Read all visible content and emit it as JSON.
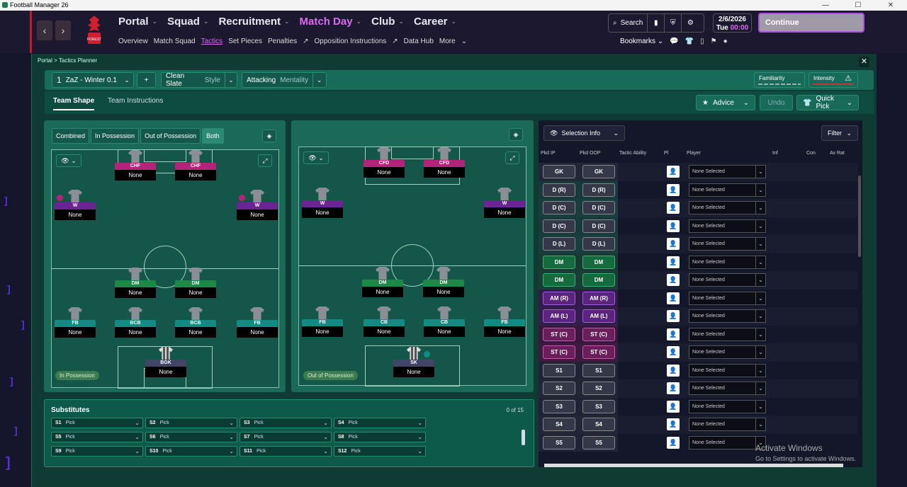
{
  "window": {
    "title": "Football Manager 26",
    "controls": [
      "—",
      "☐",
      "✕"
    ]
  },
  "nav": {
    "back": "‹",
    "forward": "›",
    "crest_text": "FOREST",
    "menu": [
      {
        "label": "Portal"
      },
      {
        "label": "Squad"
      },
      {
        "label": "Recruitment"
      },
      {
        "label": "Match Day"
      },
      {
        "label": "Club"
      },
      {
        "label": "Career"
      }
    ],
    "submenu": [
      "Overview",
      "Match Squad",
      "Tactics",
      "Set Pieces",
      "Penalties",
      "Opposition Instructions",
      "Data Hub",
      "More"
    ],
    "search_label": "Search",
    "date": "2/6/2026",
    "day": "Tue",
    "time": "00:00",
    "continue_label": "Continue",
    "bookmarks_label": "Bookmarks"
  },
  "breadcrumb": {
    "root": "Portal",
    "current": "Tactics Planner"
  },
  "toolbar": {
    "tactic_slot": "1",
    "tactic_name": "ZaZ - Winter 0.1",
    "add": "+",
    "style_value": "Clean Slate",
    "style_label": "Style",
    "mentality_value": "Attacking",
    "mentality_label": "Mentality",
    "familiarity": "Familiarity",
    "intensity": "Intensity"
  },
  "tabs": {
    "team_shape": "Team Shape",
    "team_instructions": "Team Instructions",
    "advice": "Advice",
    "undo": "Undo",
    "quick_pick": "Quick Pick"
  },
  "modes": [
    "Combined",
    "In Possession",
    "Out of Possession",
    "Both"
  ],
  "in_possession_label": "In Possession",
  "out_possession_label": "Out of Possession",
  "ip_players": [
    {
      "pos": "CHF",
      "name": "None",
      "c": "pink"
    },
    {
      "pos": "CHF",
      "name": "None",
      "c": "pink"
    },
    {
      "pos": "W",
      "name": "None",
      "c": "purple"
    },
    {
      "pos": "W",
      "name": "None",
      "c": "purple"
    },
    {
      "pos": "DM",
      "name": "None",
      "c": "green"
    },
    {
      "pos": "DM",
      "name": "None",
      "c": "green"
    },
    {
      "pos": "FB",
      "name": "None",
      "c": "teal"
    },
    {
      "pos": "BCB",
      "name": "None",
      "c": "teal"
    },
    {
      "pos": "BCB",
      "name": "None",
      "c": "teal"
    },
    {
      "pos": "FB",
      "name": "None",
      "c": "teal"
    },
    {
      "pos": "BGK",
      "name": "None",
      "c": "slate"
    }
  ],
  "oop_players": [
    {
      "pos": "CFD",
      "name": "None",
      "c": "pink"
    },
    {
      "pos": "CFD",
      "name": "None",
      "c": "pink"
    },
    {
      "pos": "W",
      "name": "None",
      "c": "purple"
    },
    {
      "pos": "W",
      "name": "None",
      "c": "purple"
    },
    {
      "pos": "DM",
      "name": "None",
      "c": "green"
    },
    {
      "pos": "DM",
      "name": "None",
      "c": "green"
    },
    {
      "pos": "FB",
      "name": "None",
      "c": "teal"
    },
    {
      "pos": "CB",
      "name": "None",
      "c": "teal"
    },
    {
      "pos": "CB",
      "name": "None",
      "c": "teal"
    },
    {
      "pos": "FB",
      "name": "None",
      "c": "teal"
    },
    {
      "pos": "SK",
      "name": "None",
      "c": "slate"
    }
  ],
  "substitutes": {
    "title": "Substitutes",
    "count": "0 of 15",
    "picks": [
      {
        "slot": "S1",
        "label": "Pick"
      },
      {
        "slot": "S2",
        "label": "Pick"
      },
      {
        "slot": "S3",
        "label": "Pick"
      },
      {
        "slot": "S4",
        "label": "Pick"
      },
      {
        "slot": "S5",
        "label": "Pick"
      },
      {
        "slot": "S6",
        "label": "Pick"
      },
      {
        "slot": "S7",
        "label": "Pick"
      },
      {
        "slot": "S8",
        "label": "Pick"
      },
      {
        "slot": "S9",
        "label": "Pick"
      },
      {
        "slot": "S10",
        "label": "Pick"
      },
      {
        "slot": "S11",
        "label": "Pick"
      },
      {
        "slot": "S12",
        "label": "Pick"
      }
    ]
  },
  "selection": {
    "info_label": "Selection Info",
    "filter_label": "Filter",
    "columns": [
      "Pkd IP",
      "Pkd OOP",
      "Tactic Ability",
      "Pl",
      "Player",
      "Inf",
      "Con",
      "Av Rat"
    ],
    "rows": [
      {
        "ip": "GK",
        "oop": "GK",
        "t": "gk",
        "player": "None Selected"
      },
      {
        "ip": "D (R)",
        "oop": "D (R)",
        "t": "df",
        "player": "None Selected"
      },
      {
        "ip": "D (C)",
        "oop": "D (C)",
        "t": "df",
        "player": "None Selected"
      },
      {
        "ip": "D (C)",
        "oop": "D (C)",
        "t": "df",
        "player": "None Selected"
      },
      {
        "ip": "D (L)",
        "oop": "D (L)",
        "t": "df",
        "player": "None Selected"
      },
      {
        "ip": "DM",
        "oop": "DM",
        "t": "dm",
        "player": "None Selected"
      },
      {
        "ip": "DM",
        "oop": "DM",
        "t": "dm",
        "player": "None Selected"
      },
      {
        "ip": "AM (R)",
        "oop": "AM (R)",
        "t": "am",
        "player": "None Selected"
      },
      {
        "ip": "AM (L)",
        "oop": "AM (L)",
        "t": "am",
        "player": "None Selected"
      },
      {
        "ip": "ST (C)",
        "oop": "ST (C)",
        "t": "st",
        "player": "None Selected"
      },
      {
        "ip": "ST (C)",
        "oop": "ST (C)",
        "t": "st",
        "player": "None Selected"
      },
      {
        "ip": "S1",
        "oop": "S1",
        "t": "sb",
        "player": "None Selected"
      },
      {
        "ip": "S2",
        "oop": "S2",
        "t": "sb",
        "player": "None Selected"
      },
      {
        "ip": "S3",
        "oop": "S3",
        "t": "sb",
        "player": "None Selected"
      },
      {
        "ip": "S4",
        "oop": "S4",
        "t": "sb",
        "player": "None Selected"
      },
      {
        "ip": "S5",
        "oop": "S5",
        "t": "sb",
        "player": "None Selected"
      }
    ]
  },
  "watermark": {
    "line1": "Activate Windows",
    "line2": "Go to Settings to activate Windows."
  }
}
